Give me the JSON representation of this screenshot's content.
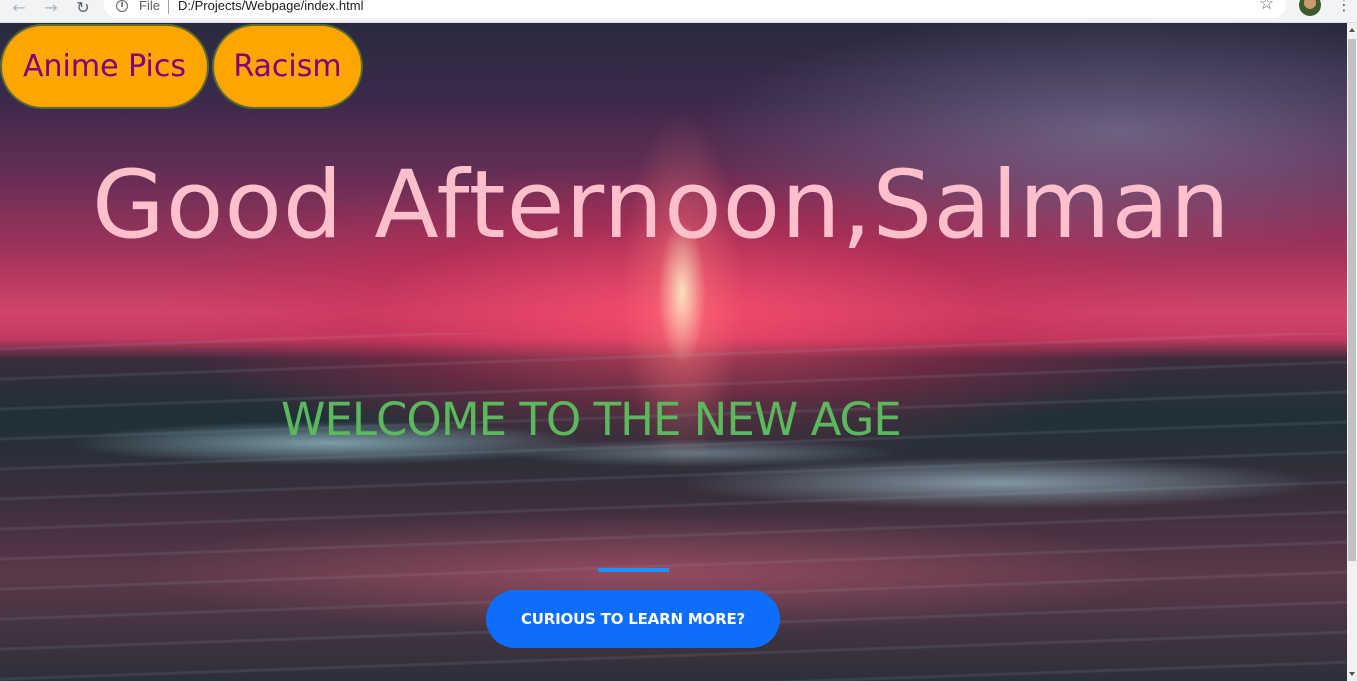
{
  "browser": {
    "file_label": "File",
    "url": "D:/Projects/Webpage/index.html",
    "icons": [
      "back-icon",
      "forward-icon",
      "reload-icon",
      "info-icon",
      "star-icon",
      "menu-icon"
    ]
  },
  "nav": {
    "buttons": [
      {
        "label": "Anime Pics"
      },
      {
        "label": "Racism"
      }
    ]
  },
  "hero": {
    "greeting": "Good Afternoon,Salman",
    "welcome": "WELCOME TO THE NEW AGE",
    "cta_label": "CURIOUS TO LEARN MORE?"
  },
  "colors": {
    "nav_button_bg": "#ffa500",
    "nav_button_text": "#800080",
    "greeting_text": "#ffc0cb",
    "welcome_text": "#5cb85c",
    "divider": "#1e90ff",
    "cta_bg": "#0d6efd"
  }
}
